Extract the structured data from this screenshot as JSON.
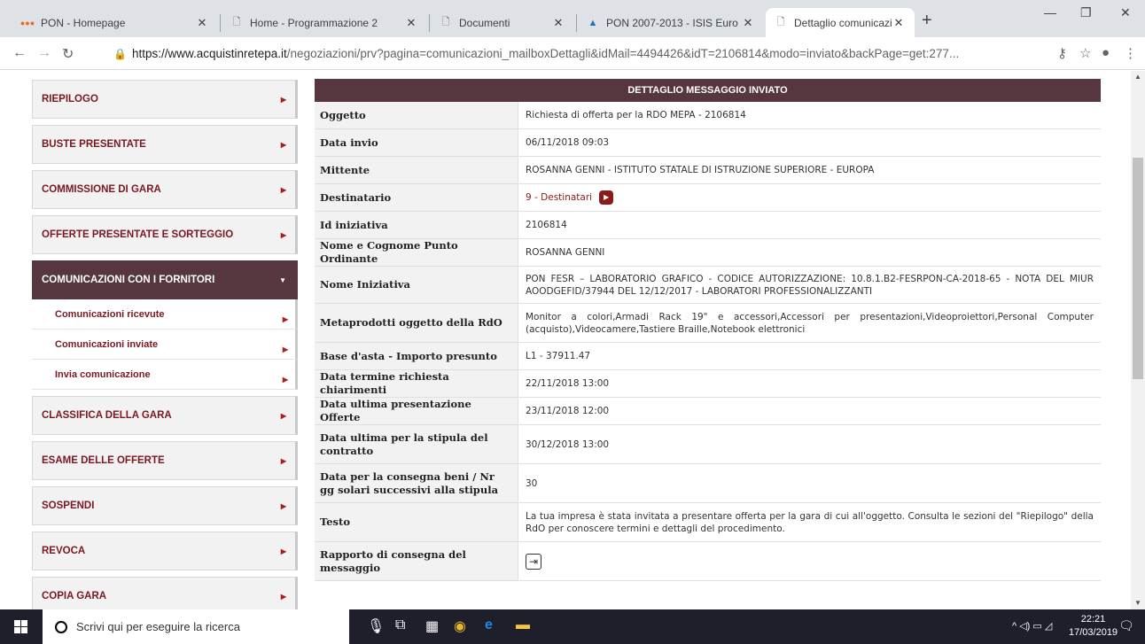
{
  "browser": {
    "tabs": [
      {
        "label": "PON - Homepage",
        "icon": "dots-icon"
      },
      {
        "label": "Home - Programmazione 2",
        "icon": "page-icon"
      },
      {
        "label": "Documenti",
        "icon": "page-icon"
      },
      {
        "label": "PON 2007-2013 - ISIS Euro",
        "icon": "site-icon"
      },
      {
        "label": "Dettaglio comunicazione",
        "icon": "page-icon"
      }
    ],
    "url_host": "https://www.acquistinretepa.it",
    "url_path": "/negoziazioni/prv?pagina=comunicazioni_mailboxDettagli&idMail=4494426&idT=2106814&modo=inviato&backPage=get:277..."
  },
  "sidebar": {
    "items_top": [
      {
        "label": "RIEPILOGO"
      },
      {
        "label": "BUSTE PRESENTATE"
      },
      {
        "label": "COMMISSIONE DI GARA"
      },
      {
        "label": "OFFERTE PRESENTATE E SORTEGGIO"
      }
    ],
    "open_item": {
      "label": "COMUNICAZIONI CON I FORNITORI"
    },
    "sub_items": [
      {
        "label": "Comunicazioni ricevute"
      },
      {
        "label": "Comunicazioni inviate"
      },
      {
        "label": "Invia comunicazione"
      }
    ],
    "items_bottom": [
      {
        "label": "CLASSIFICA DELLA GARA"
      },
      {
        "label": "ESAME DELLE OFFERTE"
      },
      {
        "label": "SOSPENDI"
      },
      {
        "label": "REVOCA"
      },
      {
        "label": "COPIA GARA"
      }
    ]
  },
  "detail": {
    "title": "DETTAGLIO MESSAGGIO INVIATO",
    "rows": [
      {
        "label": "Oggetto",
        "value": "Richiesta di offerta per la RDO MEPA - 2106814"
      },
      {
        "label": "Data invio",
        "value": "06/11/2018 09:03"
      },
      {
        "label": "Mittente",
        "value": "ROSANNA GENNI - ISTITUTO STATALE DI ISTRUZIONE SUPERIORE - EUROPA"
      },
      {
        "label": "Destinatario",
        "value": "9 - Destinatari"
      },
      {
        "label": "Id iniziativa",
        "value": "2106814"
      },
      {
        "label": "Nome e Cognome Punto Ordinante",
        "value": "ROSANNA GENNI"
      },
      {
        "label": "Nome Iniziativa",
        "value": "PON FESR – LABORATORIO GRAFICO - CODICE AUTORIZZAZIONE: 10.8.1.B2-FESRPON-CA-2018-65 - NOTA DEL MIUR AOODGEFID/37944 DEL 12/12/2017 - LABORATORI PROFESSIONALIZZANTI"
      },
      {
        "label": "Metaprodotti oggetto della RdO",
        "value": "Monitor a colori,Armadi Rack 19\" e accessori,Accessori per presentazioni,Videoproiettori,Personal Computer (acquisto),Videocamere,Tastiere Braille,Notebook elettronici"
      },
      {
        "label": "Base d'asta - Importo presunto",
        "value": "L1 - 37911.47"
      },
      {
        "label": "Data termine richiesta chiarimenti",
        "value": "22/11/2018 13:00"
      },
      {
        "label": "Data ultima presentazione Offerte",
        "value": "23/11/2018 12:00"
      },
      {
        "label": "Data ultima per la stipula del contratto",
        "value": "30/12/2018 13:00"
      },
      {
        "label": "Data per la consegna beni / Nr gg solari successivi alla stipula",
        "value": "30"
      },
      {
        "label": "Testo",
        "value": "La tua impresa è stata invitata a presentare offerta per la gara di cui all'oggetto. Consulta le sezioni del \"Riepilogo\" della RdO per conoscere termini e dettagli del procedimento."
      },
      {
        "label": "Rapporto di consegna del messaggio",
        "value": ""
      }
    ]
  },
  "taskbar": {
    "search_placeholder": "Scrivi qui per eseguire la ricerca",
    "time": "22:21",
    "date": "17/03/2019"
  }
}
